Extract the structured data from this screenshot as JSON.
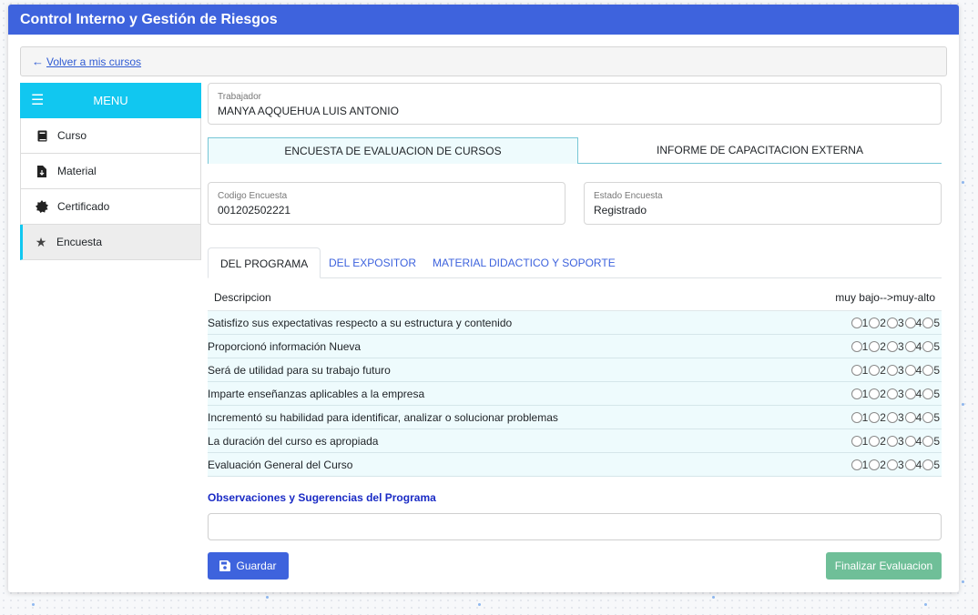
{
  "app": {
    "title": "Control Interno y Gestión de Riesgos"
  },
  "nav": {
    "back_label": "Volver a mis cursos"
  },
  "sidebar": {
    "menu_label": "MENU",
    "items": [
      {
        "label": "Curso",
        "icon": "book-icon"
      },
      {
        "label": "Material",
        "icon": "file-download-icon"
      },
      {
        "label": "Certificado",
        "icon": "certificate-icon"
      },
      {
        "label": "Encuesta",
        "icon": "star-icon",
        "active": true
      }
    ]
  },
  "worker": {
    "label": "Trabajador",
    "value": "MANYA AQQUEHUA LUIS ANTONIO"
  },
  "top_tabs": [
    "ENCUESTA DE EVALUACION DE CURSOS",
    "INFORME DE CAPACITACION EXTERNA"
  ],
  "survey": {
    "code_label": "Codigo Encuesta",
    "code_value": "001202502221",
    "state_label": "Estado Encuesta",
    "state_value": "Registrado"
  },
  "sub_tabs": [
    "DEL PROGRAMA",
    "DEL EXPOSITOR",
    "MATERIAL DIDACTICO Y SOPORTE"
  ],
  "table": {
    "col_description": "Descripcion",
    "col_scale": "muy bajo-->muy-alto",
    "scale": [
      "1",
      "2",
      "3",
      "4",
      "5"
    ],
    "questions": [
      "Satisfizo sus expectativas respecto a su estructura y contenido",
      "Proporcionó información Nueva",
      "Será de utilidad para su trabajo futuro",
      "Imparte enseñanzas aplicables a la empresa",
      "Incrementó su habilidad para identificar, analizar o solucionar problemas",
      "La duración del curso es apropiada",
      "Evaluación General del Curso"
    ]
  },
  "observations": {
    "label": "Observaciones y Sugerencias del Programa",
    "value": ""
  },
  "buttons": {
    "save": "Guardar",
    "finish": "Finalizar Evaluacion"
  },
  "colors": {
    "header": "#3e63dd",
    "menu": "#11c7f0",
    "finish": "#6fbf98"
  }
}
